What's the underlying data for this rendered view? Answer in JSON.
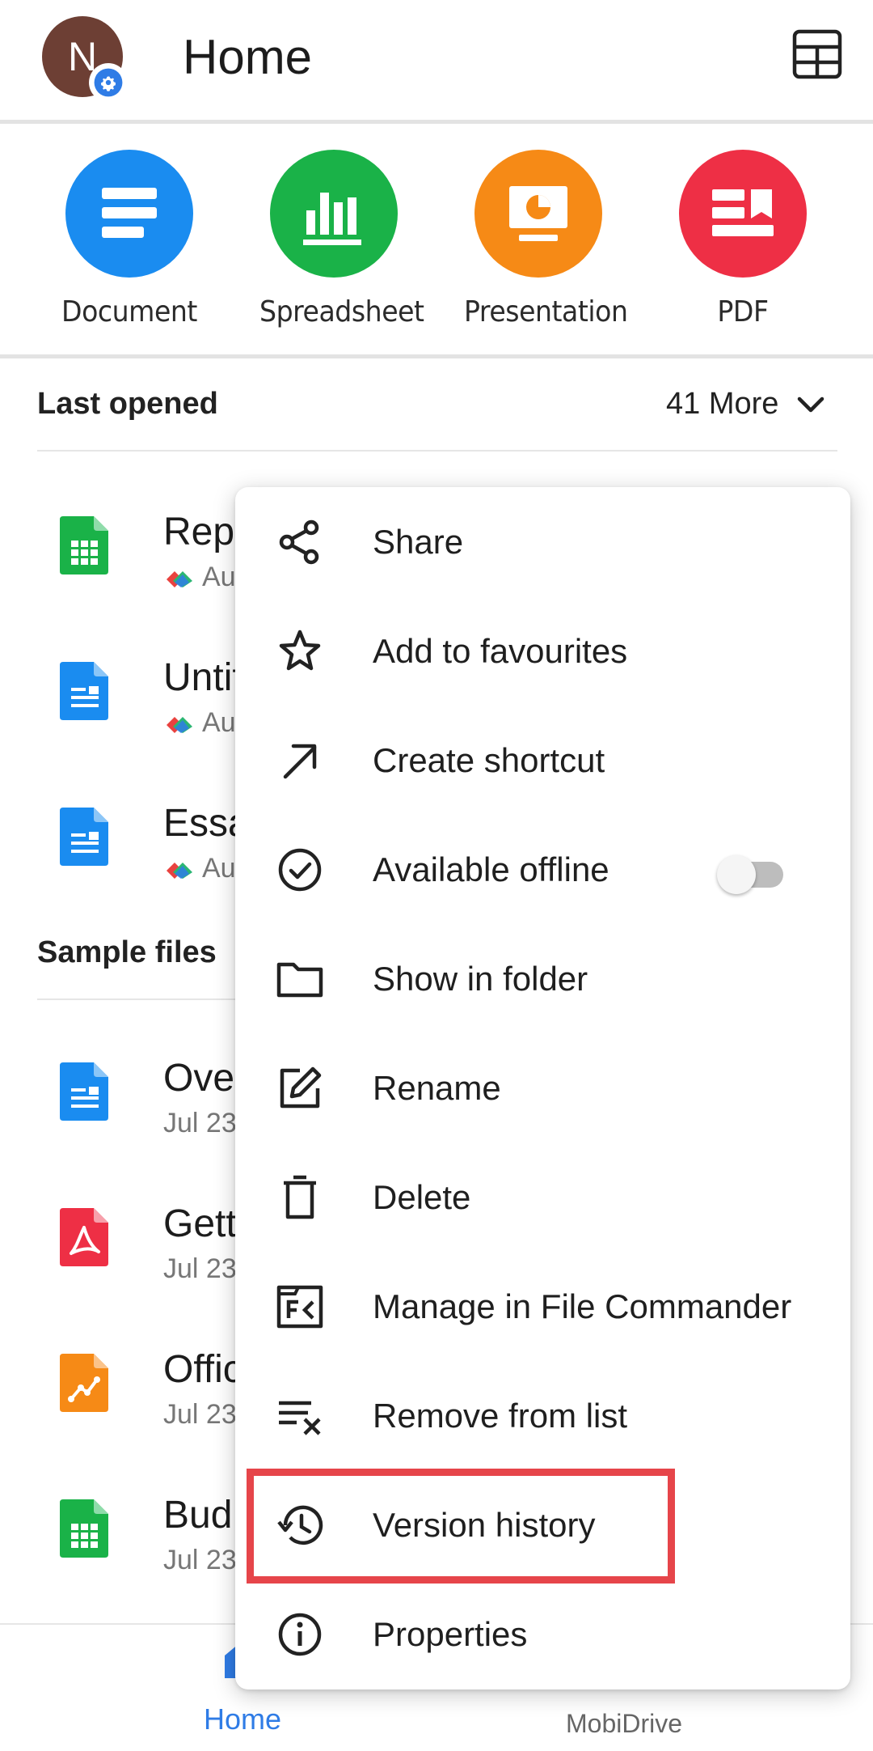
{
  "header": {
    "avatar_letter": "N",
    "title": "Home"
  },
  "create": [
    {
      "label": "Document",
      "color": "#1a8cf0"
    },
    {
      "label": "Spreadsheet",
      "color": "#1ab248"
    },
    {
      "label": "Presentation",
      "color": "#f68a16"
    },
    {
      "label": "PDF",
      "color": "#ee2f45"
    }
  ],
  "last_opened": {
    "title": "Last opened",
    "more_label": "41 More",
    "files": [
      {
        "name": "Repo",
        "sub": "Au",
        "type": "spreadsheet"
      },
      {
        "name": "Untit",
        "sub": "Au",
        "type": "document"
      },
      {
        "name": "Essa",
        "sub": "Au",
        "type": "document"
      }
    ]
  },
  "sample_files": {
    "title": "Sample files",
    "files": [
      {
        "name": "Over",
        "sub": "Jul 23",
        "type": "document"
      },
      {
        "name": "Gett",
        "sub": "Jul 23",
        "type": "pdf"
      },
      {
        "name": "Offic",
        "sub": "Jul 23",
        "type": "presentation"
      },
      {
        "name": "Bud",
        "sub": "Jul 23",
        "type": "spreadsheet"
      }
    ]
  },
  "menu": {
    "items": [
      {
        "label": "Share",
        "icon": "share-icon"
      },
      {
        "label": "Add to favourites",
        "icon": "star-icon"
      },
      {
        "label": "Create shortcut",
        "icon": "arrow-up-right-icon"
      },
      {
        "label": "Available offline",
        "icon": "check-circle-icon",
        "toggle": false
      },
      {
        "label": "Show in folder",
        "icon": "folder-icon"
      },
      {
        "label": "Rename",
        "icon": "edit-icon"
      },
      {
        "label": "Delete",
        "icon": "trash-icon"
      },
      {
        "label": "Manage in File Commander",
        "icon": "file-commander-icon"
      },
      {
        "label": "Remove from list",
        "icon": "clear-list-icon"
      },
      {
        "label": "Version history",
        "icon": "history-icon"
      },
      {
        "label": "Properties",
        "icon": "info-icon"
      }
    ]
  },
  "bottom_nav": {
    "home_label": "Home",
    "drive_label": "MobiDrive"
  },
  "colors": {
    "accent_blue": "#2f7ce6",
    "highlight": "#e6454a"
  }
}
